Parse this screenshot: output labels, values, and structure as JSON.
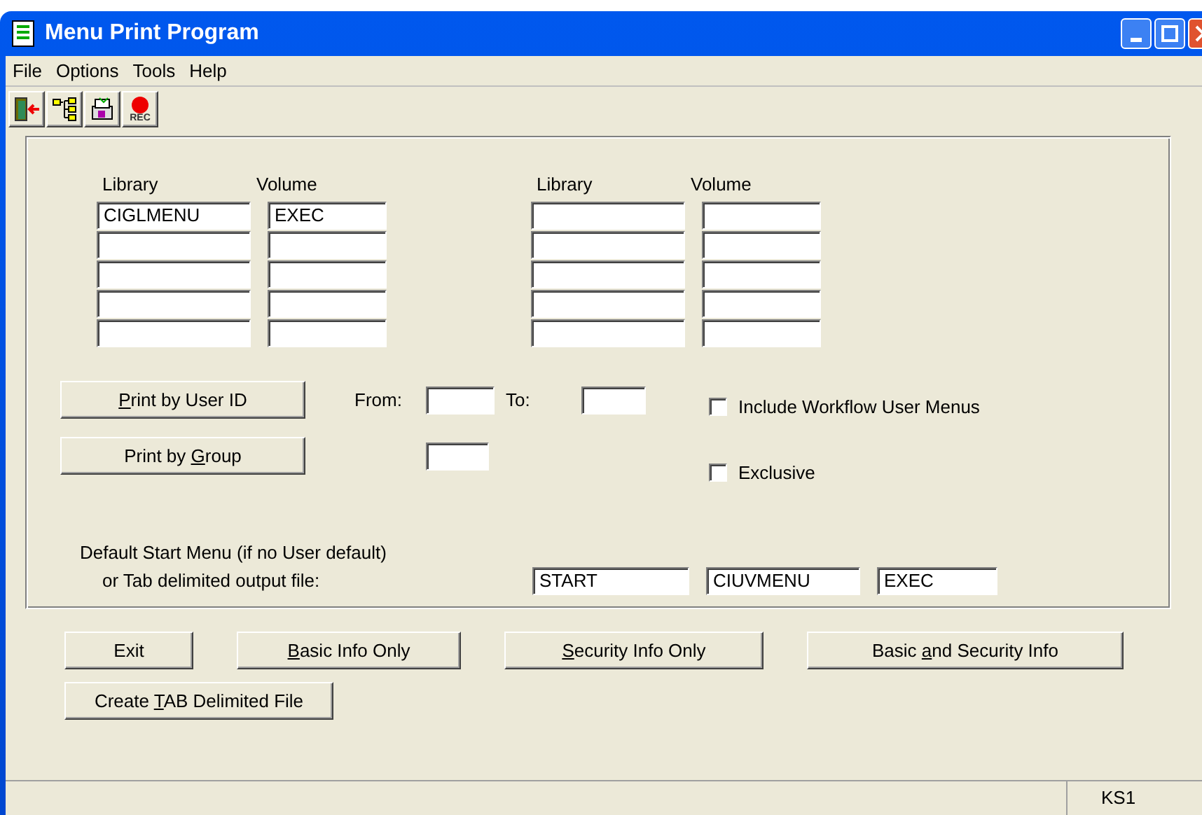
{
  "window": {
    "title": "Menu Print Program"
  },
  "menu": [
    "File",
    "Options",
    "Tools",
    "Help"
  ],
  "toolbar": [
    {
      "kind": "exit"
    },
    {
      "kind": "tree"
    },
    {
      "kind": "print"
    },
    {
      "kind": "rec",
      "label": "REC"
    }
  ],
  "library_groups": [
    {
      "library_label": "Library",
      "volume_label": "Volume",
      "rows": [
        {
          "library": "CIGLMENU",
          "volume": "EXEC"
        },
        {},
        {},
        {},
        {}
      ]
    },
    {
      "library_label": "Library",
      "volume_label": "Volume",
      "rows": [
        {},
        {},
        {},
        {},
        {}
      ]
    }
  ],
  "print_by_user": {
    "button": {
      "key": "P",
      "after": "rint by User ID"
    },
    "from_label": "From:",
    "to_label": "To:"
  },
  "print_by_group": {
    "button": {
      "before": "Print by ",
      "key": "G",
      "after": "roup"
    }
  },
  "options": [
    {
      "label": "Include Workflow User Menus",
      "checked": false
    },
    {
      "label": "Exclusive",
      "checked": false
    }
  ],
  "default_start": {
    "line_1": "Default Start Menu (if no User default)",
    "line_2": "or Tab delimited output file:",
    "fields": [
      "START",
      "CIUVMENU",
      "EXEC"
    ]
  },
  "actions": [
    {
      "parts": {
        "before": "Exit"
      }
    },
    {
      "parts": {
        "key": "B",
        "after": "asic Info Only"
      }
    },
    {
      "parts": {
        "key": "S",
        "after": "ecurity Info Only"
      }
    },
    {
      "parts": {
        "before": "Basic ",
        "key": "a",
        "after": "nd Security Info"
      }
    }
  ],
  "actions_2": [
    {
      "parts": {
        "before": "Create ",
        "key": "T",
        "after": "AB Delimited File"
      }
    }
  ],
  "status_bar": {
    "panel": "KS1"
  }
}
